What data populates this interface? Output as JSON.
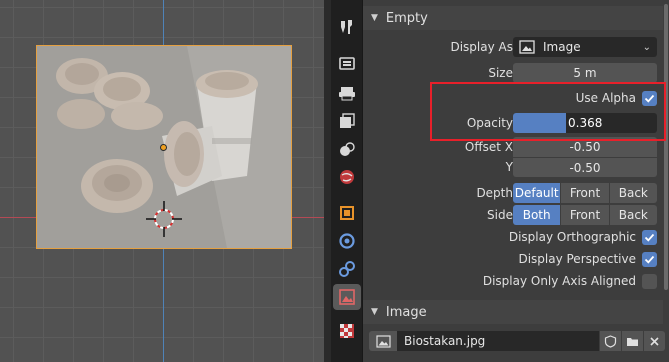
{
  "panel": {
    "empty_header": "Empty",
    "image_header": "Image"
  },
  "empty": {
    "display_as_label": "Display As",
    "display_as_value": "Image",
    "size_label": "Size",
    "size_value": "5 m",
    "use_alpha_label": "Use Alpha",
    "use_alpha_checked": true,
    "opacity_label": "Opacity",
    "opacity_value": "0.368",
    "opacity_fraction": 0.368,
    "offset_x_label": "Offset X",
    "offset_x_value": "-0.50",
    "offset_y_label": "Y",
    "offset_y_value": "-0.50",
    "depth_label": "Depth",
    "depth_options": [
      "Default",
      "Front",
      "Back"
    ],
    "depth_selected": "Default",
    "side_label": "Side",
    "side_options": [
      "Both",
      "Front",
      "Back"
    ],
    "side_selected": "Both",
    "display_orthographic_label": "Display Orthographic",
    "display_orthographic_checked": true,
    "display_perspective_label": "Display Perspective",
    "display_perspective_checked": true,
    "display_axis_aligned_label": "Display Only Axis Aligned",
    "display_axis_aligned_checked": false
  },
  "image": {
    "filename": "Biostakan.jpg"
  },
  "tabs": [
    "tool-icon",
    "render-icon",
    "output-icon",
    "view-layer-icon",
    "scene-icon",
    "world-icon",
    "object-icon",
    "modifier-icon",
    "physics-icon",
    "object-data-empty-icon",
    "texture-icon"
  ],
  "active_tab": "object-data-empty-icon",
  "colors": {
    "accent": "#5680c2",
    "selection_outline": "#e5a041",
    "highlight_box": "#e8202a",
    "x_axis": "#b44a55",
    "y_axis": "#4f83b8"
  }
}
